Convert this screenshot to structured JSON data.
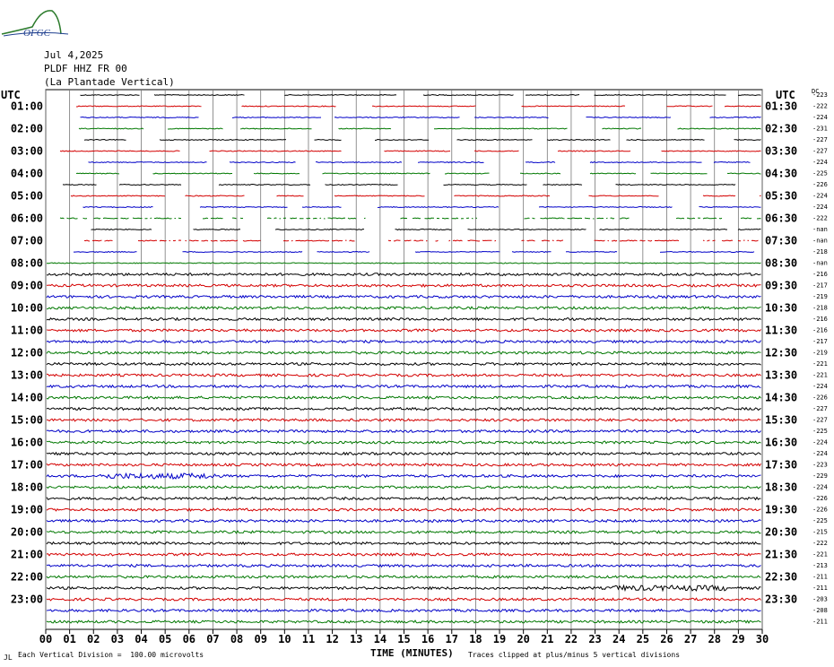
{
  "header": {
    "date": "Jul 4,2025",
    "station": "PLDF HHZ FR 00",
    "location": "(La Plantade Vertical)",
    "logo_text": "OFGC"
  },
  "chart_data": {
    "type": "line",
    "title": "PLDF HHZ FR 00",
    "xlabel": "TIME (MINUTES)",
    "xlim": [
      0,
      30
    ],
    "x_ticks": [
      "00",
      "01",
      "02",
      "03",
      "04",
      "05",
      "06",
      "07",
      "08",
      "09",
      "10",
      "11",
      "12",
      "13",
      "14",
      "15",
      "16",
      "17",
      "18",
      "19",
      "20",
      "21",
      "22",
      "23",
      "24",
      "25",
      "26",
      "27",
      "28",
      "29",
      "30"
    ],
    "left_axis_label": "UTC",
    "right_axis_label": "UTC",
    "dc_label": "DC",
    "left_ticks": [
      "01:00",
      "02:00",
      "03:00",
      "04:00",
      "05:00",
      "06:00",
      "07:00",
      "08:00",
      "09:00",
      "10:00",
      "11:00",
      "12:00",
      "13:00",
      "14:00",
      "15:00",
      "16:00",
      "17:00",
      "18:00",
      "19:00",
      "20:00",
      "21:00",
      "22:00",
      "23:00"
    ],
    "right_ticks": [
      "01:30",
      "02:30",
      "03:30",
      "04:30",
      "05:30",
      "06:30",
      "07:30",
      "08:30",
      "09:30",
      "10:30",
      "11:30",
      "12:30",
      "13:30",
      "14:30",
      "15:30",
      "16:30",
      "17:30",
      "18:30",
      "19:30",
      "20:30",
      "21:30",
      "22:30",
      "23:30"
    ],
    "dc_offsets": [
      "-223",
      "-222",
      "-224",
      "-231",
      "-227",
      "-227",
      "-224",
      "-225",
      "-226",
      "-224",
      "-224",
      "-222",
      "-nan",
      "-nan",
      "-218",
      "-nan",
      "-216",
      "-217",
      "-219",
      "-218",
      "-216",
      "-216",
      "-217",
      "-219",
      "-221",
      "-221",
      "-224",
      "-226",
      "-227",
      "-227",
      "-225",
      "-224",
      "-224",
      "-223",
      "-229",
      "-224",
      "-226",
      "-226",
      "-225",
      "-215",
      "-222",
      "-221",
      "-213",
      "-211",
      "-211",
      "-203",
      "-208",
      "-211"
    ],
    "trace_colors": [
      "#000000",
      "#d40000",
      "#0000c8",
      "#007800"
    ],
    "grid": true,
    "footer_scale": "Each Vertical Division =  100.00 microvolts",
    "footer_clip": "Traces clipped at plus/minus 5 vertical divisions",
    "footer_mark": "JL"
  }
}
